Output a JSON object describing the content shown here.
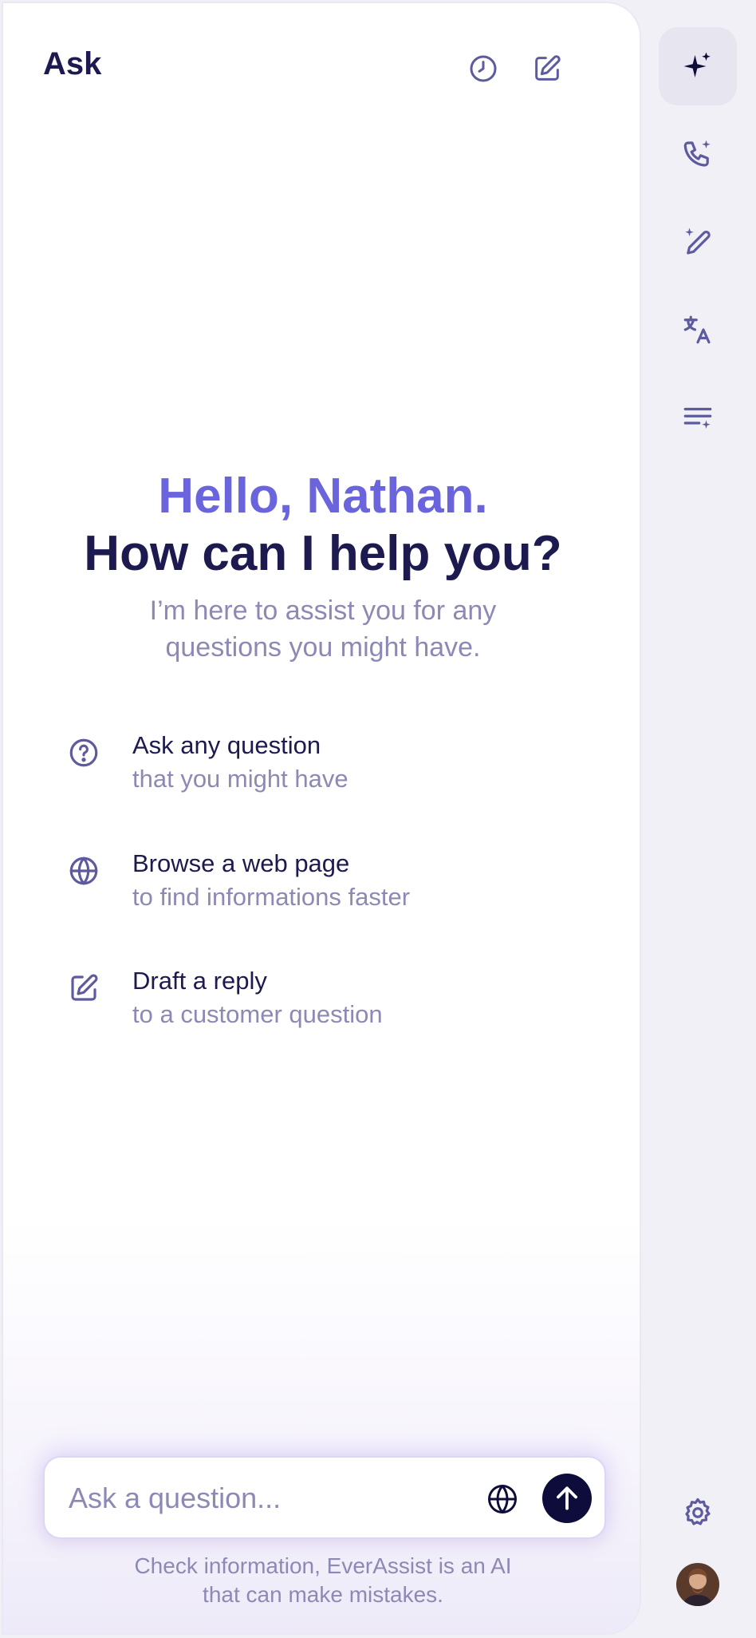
{
  "header": {
    "title": "Ask",
    "history_icon": "history-clock-icon",
    "new_chat_icon": "edit-compose-icon"
  },
  "hero": {
    "greeting": "Hello, Nathan.",
    "headline": "How can I help you?",
    "subtitle": "I’m here to assist you for any questions you might have."
  },
  "features": [
    {
      "icon": "question-circle-icon",
      "title": "Ask any question",
      "subtitle": "that you might have"
    },
    {
      "icon": "globe-icon",
      "title": "Browse a web page",
      "subtitle": "to find informations faster"
    },
    {
      "icon": "edit-icon",
      "title": "Draft a reply",
      "subtitle": "to a customer question"
    }
  ],
  "composer": {
    "placeholder": "Ask a question...",
    "globe_icon": "globe-icon",
    "send_icon": "arrow-up-icon"
  },
  "disclaimer": "Check information, EverAssist is an AI that can make mistakes.",
  "rail": {
    "items": [
      "sparkle-icon",
      "phone-sparkle-icon",
      "pencil-sparkle-icon",
      "translate-icon",
      "summary-list-icon"
    ],
    "settings_icon": "settings-gear-icon",
    "avatar": "user-avatar"
  },
  "colors": {
    "primary_dark": "#1c1a4f",
    "accent": "#6b65dd",
    "muted": "#8d89b5",
    "rail_bg": "#f0f0f6",
    "icon": "#5d5a9e"
  }
}
